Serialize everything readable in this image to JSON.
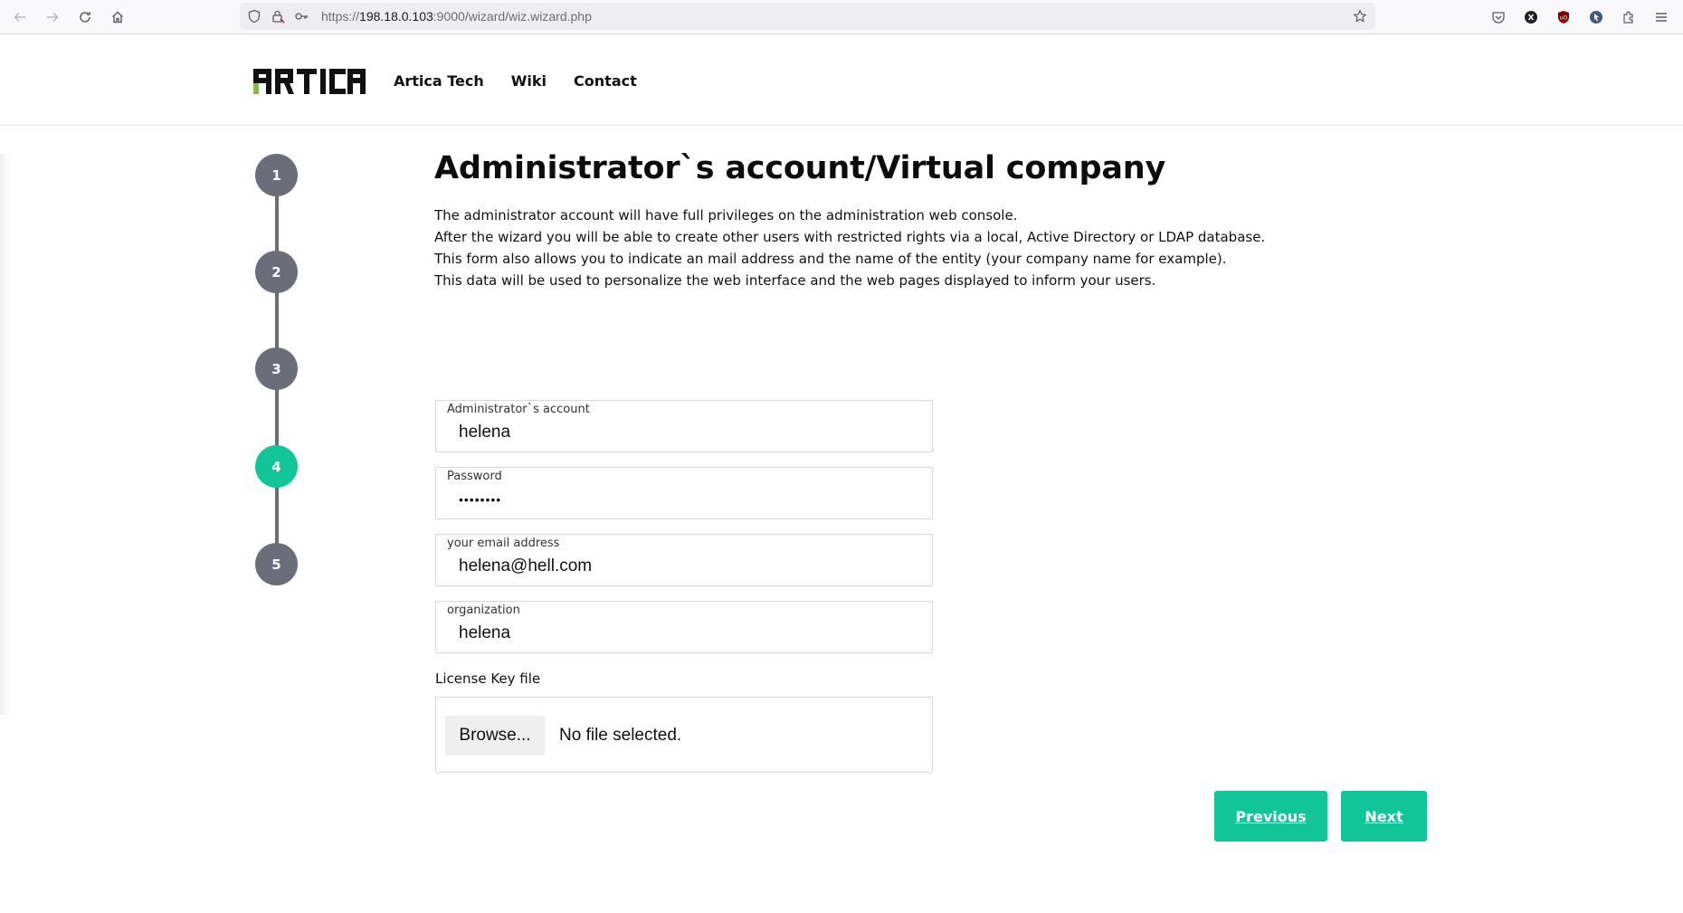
{
  "browser": {
    "url_prefix": "https://",
    "url_host": "198.18.0.103",
    "url_rest": ":9000/wizard/wiz.wizard.php"
  },
  "header": {
    "logo_text": "ARTICA",
    "nav": [
      "Artica Tech",
      "Wiki",
      "Contact"
    ]
  },
  "steps": [
    {
      "label": "1",
      "active": false
    },
    {
      "label": "2",
      "active": false
    },
    {
      "label": "3",
      "active": false
    },
    {
      "label": "4",
      "active": true
    },
    {
      "label": "5",
      "active": false
    }
  ],
  "main": {
    "title": "Administrator`s account/Virtual company",
    "description": [
      "The administrator account will have full privileges on the administration web console.",
      "After the wizard you will be able to create other users with restricted rights via a local, Active Directory or LDAP database.",
      "This form also allows you to indicate an mail address and the name of the entity (your company name for example).",
      "This data will be used to personalize the web interface and the web pages displayed to inform your users."
    ],
    "fields": {
      "admin": {
        "label": "Administrator`s account",
        "value": "helena"
      },
      "password": {
        "label": "Password",
        "value": "helena12"
      },
      "email": {
        "label": "your email address",
        "value": "helena@hell.com"
      },
      "org": {
        "label": "organization",
        "value": "helena"
      }
    },
    "license_label": "License Key file",
    "browse_label": "Browse...",
    "file_status": "No file selected.",
    "previous_label": "Previous",
    "next_label": "Next"
  },
  "colors": {
    "accent": "#11c598",
    "step_inactive": "#6b6e78",
    "logo_green": "#7dc242"
  }
}
